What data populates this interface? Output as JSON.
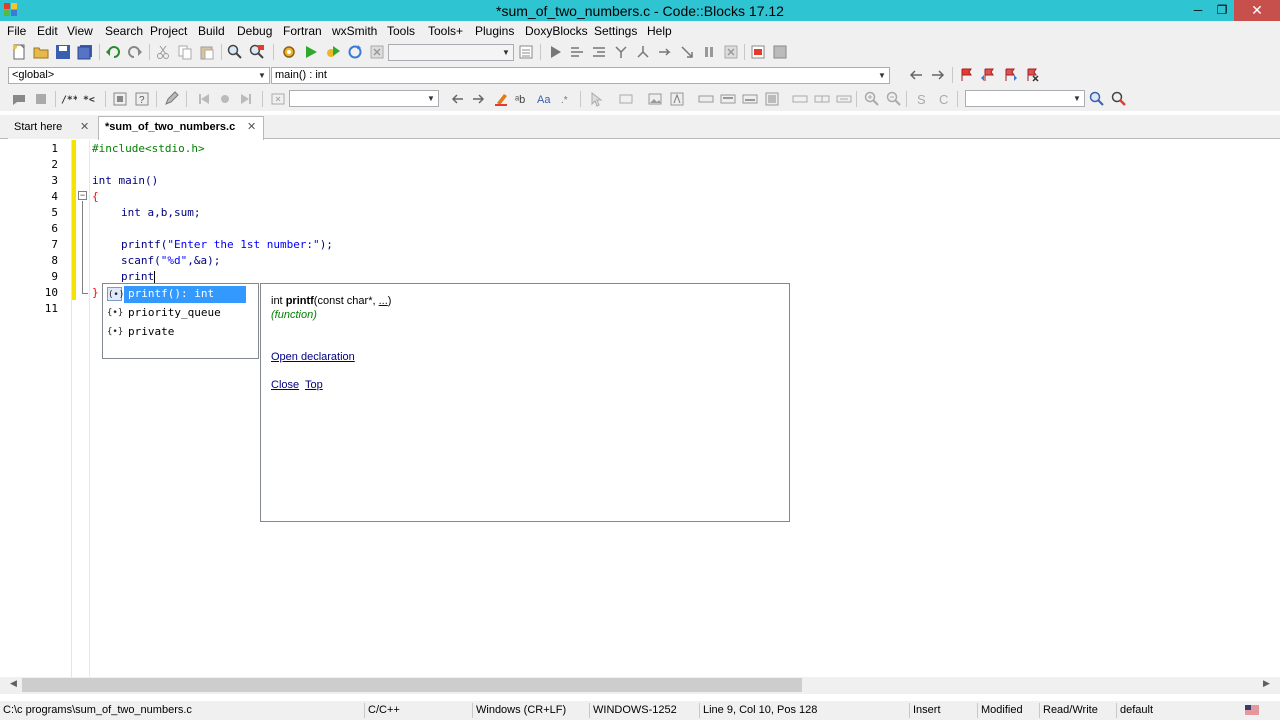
{
  "window": {
    "title": "*sum_of_two_numbers.c - Code::Blocks 17.12",
    "minimize": "─",
    "maximize": "❐",
    "close": "✕"
  },
  "menu": [
    "File",
    "Edit",
    "View",
    "Search",
    "Project",
    "Build",
    "Debug",
    "Fortran",
    "wxSmith",
    "Tools",
    "Tools+",
    "Plugins",
    "DoxyBlocks",
    "Settings",
    "Help"
  ],
  "scope": {
    "global_value": "<global>",
    "function_value": "main() : int"
  },
  "tabs": [
    {
      "label": "Start here",
      "close": "✕"
    },
    {
      "label": "*sum_of_two_numbers.c",
      "close": "✕"
    }
  ],
  "code": {
    "line_numbers": [
      "1",
      "2",
      "3",
      "4",
      "5",
      "6",
      "7",
      "8",
      "9",
      "10",
      "11"
    ],
    "lines": {
      "l1_pp": "#include",
      "l1_rest": "<stdio.h>",
      "l3_kw": "int",
      "l3_rest": " main()",
      "l4": "{",
      "l5_kw": "int",
      "l5_rest": " a,b,sum;",
      "l7_fn": "printf(",
      "l7_str": "\"Enter the 1st number:\"",
      "l7_end": ");",
      "l8_fn": "scanf(",
      "l8_str": "\"%d\"",
      "l8_end": ",&a);",
      "l9": "print",
      "l10": "}"
    }
  },
  "autocomplete": {
    "items": [
      {
        "icon": "(•)",
        "label": "printf(): int"
      },
      {
        "icon": "{•}",
        "label": "priority_queue"
      },
      {
        "icon": "{•}",
        "label": "private"
      }
    ]
  },
  "doc_popup": {
    "sig_prefix": "int ",
    "sig_name": "printf",
    "sig_args": "(const char*, ",
    "sig_ellipsis": "...",
    "sig_close": ")",
    "kind": "(function)",
    "open_declaration": "Open declaration",
    "close": "Close",
    "top": "Top"
  },
  "status": {
    "path": "C:\\c programs\\sum_of_two_numbers.c",
    "language": "C/C++",
    "line_endings": "Windows (CR+LF)",
    "encoding": "WINDOWS-1252",
    "position": "Line 9, Col 10, Pos 128",
    "mode": "Insert",
    "modified": "Modified",
    "access": "Read/Write",
    "profile": "default"
  },
  "colors": {
    "titlebar": "#2fc4d2",
    "close_button": "#c7504d",
    "selection": "#3399ff",
    "change_bar": "#f5e400"
  }
}
